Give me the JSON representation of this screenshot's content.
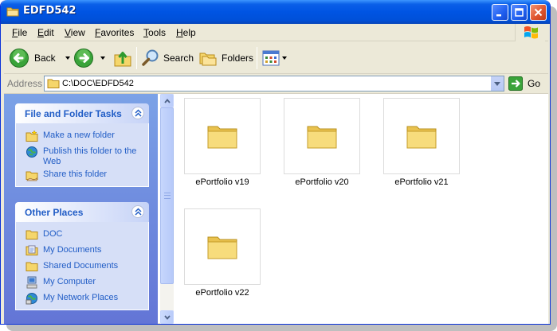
{
  "window": {
    "title": "EDFD542"
  },
  "menu": [
    "File",
    "Edit",
    "View",
    "Favorites",
    "Tools",
    "Help"
  ],
  "toolbar": {
    "back_label": "Back",
    "search_label": "Search",
    "folders_label": "Folders"
  },
  "address": {
    "label": "Address",
    "path": "C:\\DOC\\EDFD542",
    "go_label": "Go"
  },
  "tasks_panel": {
    "title": "File and Folder Tasks",
    "items": [
      {
        "label": "Make a new folder",
        "icon": "new-folder-icon"
      },
      {
        "label": "Publish this folder to the Web",
        "icon": "publish-web-icon"
      },
      {
        "label": "Share this folder",
        "icon": "share-folder-icon"
      }
    ]
  },
  "places_panel": {
    "title": "Other Places",
    "items": [
      {
        "label": "DOC",
        "icon": "folder-icon"
      },
      {
        "label": "My Documents",
        "icon": "my-documents-icon"
      },
      {
        "label": "Shared Documents",
        "icon": "folder-icon"
      },
      {
        "label": "My Computer",
        "icon": "my-computer-icon"
      },
      {
        "label": "My Network Places",
        "icon": "network-places-icon"
      }
    ]
  },
  "files": [
    {
      "name": "ePortfolio v19"
    },
    {
      "name": "ePortfolio v20"
    },
    {
      "name": "ePortfolio v21"
    },
    {
      "name": "ePortfolio v22"
    }
  ],
  "colors": {
    "title_blue": "#0054e3",
    "link_blue": "#215dc6",
    "task_pane": "#7ba2e7",
    "folder_yellow": "#f5d66b"
  }
}
